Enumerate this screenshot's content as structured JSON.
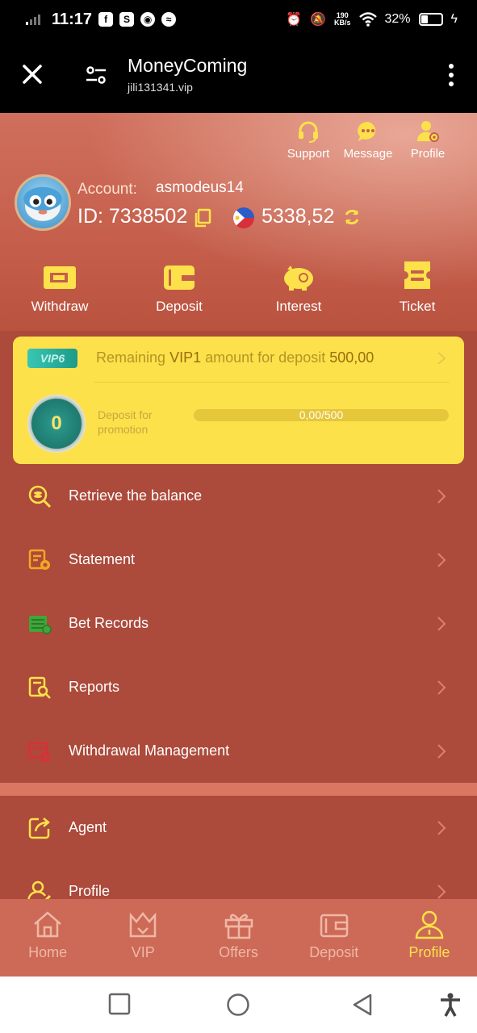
{
  "status_bar": {
    "time": "11:17",
    "net_speed_value": "190",
    "net_speed_unit": "KB/s",
    "battery": "32%"
  },
  "browser": {
    "title": "MoneyComing",
    "url": "jili131341.vip"
  },
  "top_links": [
    {
      "label": "Support",
      "icon": "headset-icon"
    },
    {
      "label": "Message",
      "icon": "chat-bubble-icon"
    },
    {
      "label": "Profile",
      "icon": "user-gear-icon"
    }
  ],
  "account": {
    "label": "Account:",
    "name": "asmodeus14",
    "id_text": "ID: 7338502",
    "balance": "5338,52"
  },
  "actions": [
    {
      "label": "Withdraw",
      "icon": "withdraw-icon"
    },
    {
      "label": "Deposit",
      "icon": "wallet-icon"
    },
    {
      "label": "Interest",
      "icon": "piggy-bank-icon"
    },
    {
      "label": "Ticket",
      "icon": "ticket-icon"
    }
  ],
  "vip": {
    "badge": "VIP6",
    "remaining_prefix": "Remaining",
    "level": "VIP1",
    "remaining_middle": "amount for deposit",
    "amount": "500,00",
    "medal_value": "0",
    "deposit_label": "Deposit for promotion",
    "progress_text": "0,00/500",
    "progress_fraction": 0
  },
  "menu": [
    {
      "label": "Retrieve the balance",
      "icon": "coin-search-icon"
    },
    {
      "label": "Statement",
      "icon": "statement-icon"
    },
    {
      "label": "Bet Records",
      "icon": "bet-records-icon"
    },
    {
      "label": "Reports",
      "icon": "report-search-icon"
    },
    {
      "label": "Withdrawal Management",
      "icon": "withdrawal-settings-icon"
    }
  ],
  "menu2": [
    {
      "label": "Agent",
      "icon": "share-icon"
    },
    {
      "label": "Profile",
      "icon": "user-edit-icon"
    }
  ],
  "bottom_nav": [
    {
      "label": "Home",
      "icon": "home-icon"
    },
    {
      "label": "VIP",
      "icon": "crown-icon"
    },
    {
      "label": "Offers",
      "icon": "gift-icon"
    },
    {
      "label": "Deposit",
      "icon": "wallet-icon"
    },
    {
      "label": "Profile",
      "icon": "user-icon"
    }
  ],
  "colors": {
    "page_bg": "#ac4a3b",
    "accent": "#fde14a",
    "nav_bg": "#cc6a57"
  }
}
